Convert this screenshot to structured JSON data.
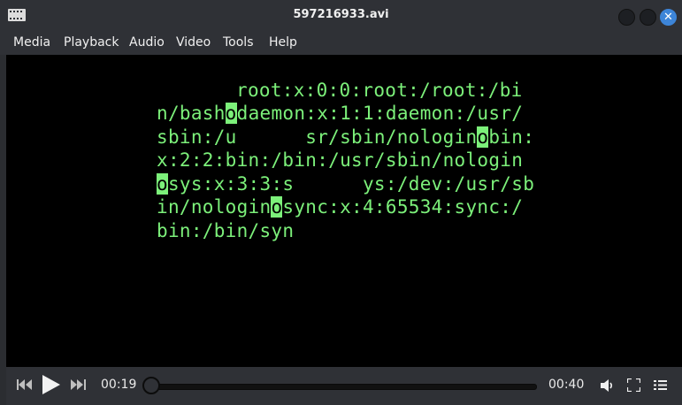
{
  "window": {
    "title": "597216933.avi"
  },
  "menu": [
    "Media",
    "Playback",
    "Audio",
    "Video",
    "Tools",
    "Help"
  ],
  "video_text": {
    "line1": "root:x:0:0:root:/root:/bi",
    "line2a": "n/bash",
    "line2b": "daemon:x:1:1:daemon:/usr/",
    "line3a": "sbin:/u      sr/sbin/nologin",
    "line3b": "bin:",
    "line4": "x:2:2:bin:/bin:/usr/sbin/nologin",
    "line5a": "",
    "line5b": "sys:x:3:3:s      ys:/dev:/usr/sb",
    "line6a": "in/nologin",
    "line6b": "sync:x:4:65534:sync:/",
    "line7": "bin:/bin/syn",
    "newline_marker": "o",
    "text_color": "#7cf07a"
  },
  "player": {
    "elapsed": "00:19",
    "duration": "00:40",
    "progress_fraction": 0.0
  },
  "colors": {
    "accent": "#3d85d8",
    "chrome": "#2f3136"
  }
}
